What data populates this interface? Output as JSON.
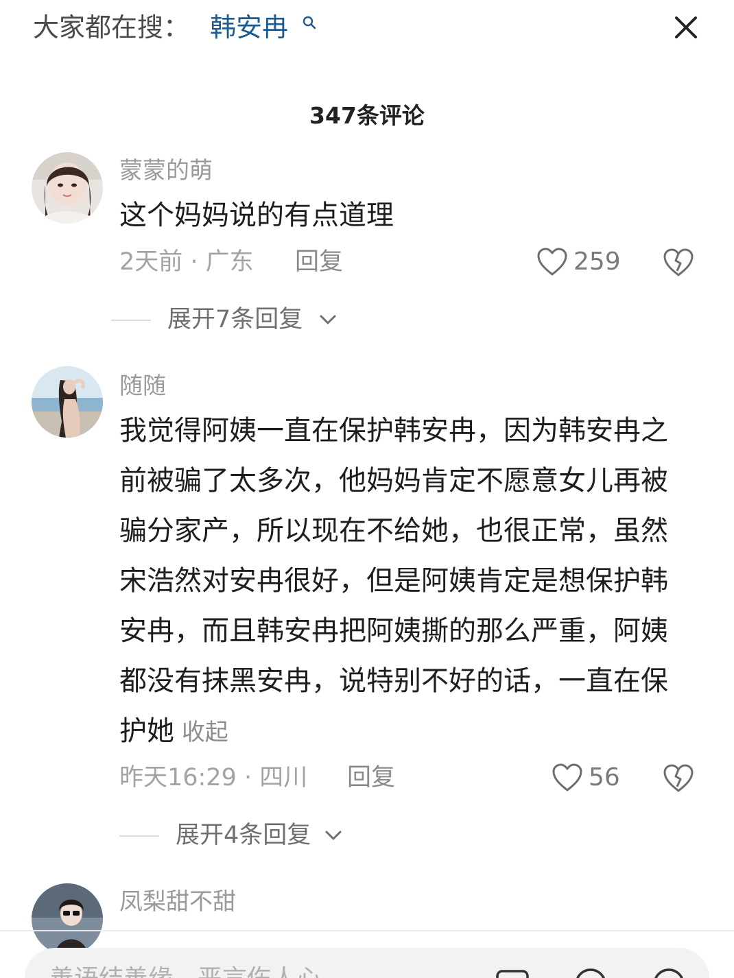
{
  "search_hint": {
    "prefix": "大家都在搜：",
    "term": "韩安冉"
  },
  "header": {
    "title": "347条评论"
  },
  "comments": [
    {
      "username": "蒙蒙的萌",
      "text": "这个妈妈说的有点道理",
      "meta": "2天前 · 广东",
      "reply_label": "回复",
      "likes": "259",
      "expand_label": "展开7条回复"
    },
    {
      "username": "随随",
      "text": "我觉得阿姨一直在保护韩安冉，因为韩安冉之前被骗了太多次，他妈妈肯定不愿意女儿再被骗分家产，所以现在不给她，也很正常，虽然宋浩然对安冉很好，但是阿姨肯定是想保护韩安冉，而且韩安冉把阿姨撕的那么严重，阿姨都没有抹黑安冉，说特别不好的话，一直在保护她",
      "collapse_label": "收起",
      "meta": "昨天16:29 · 四川",
      "reply_label": "回复",
      "likes": "56",
      "expand_label": "展开4条回复"
    },
    {
      "username": "凤梨甜不甜"
    }
  ],
  "input": {
    "placeholder": "善语结善缘，恶言伤人心"
  },
  "colors": {
    "search_term": "#1f5a8c",
    "username": "#9a9a9a",
    "text": "#1e1e1e",
    "meta": "#a3a3a3"
  },
  "icons": {
    "search": "search-icon",
    "close": "close-icon",
    "like": "heart-icon",
    "dislike": "broken-heart-icon",
    "expand": "chevron-down-icon",
    "image": "image-icon",
    "at": "at-icon",
    "emoji": "emoji-icon"
  }
}
